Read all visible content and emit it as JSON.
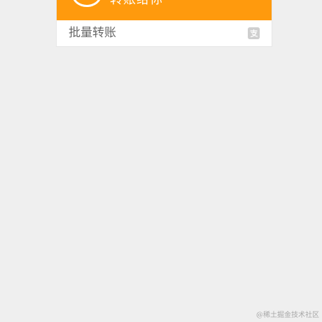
{
  "banner": {
    "title": "转账给你",
    "background_color": "#ff9a0d",
    "icon": "circle-icon"
  },
  "menu": {
    "items": [
      {
        "label": "批量转账",
        "icon": "alipay-icon",
        "icon_color": "#cfcfcf"
      }
    ]
  },
  "watermark": "@稀土掘金技术社区",
  "colors": {
    "page_background": "#efefef",
    "card_background": "#ffffff",
    "label_text": "#666666"
  }
}
